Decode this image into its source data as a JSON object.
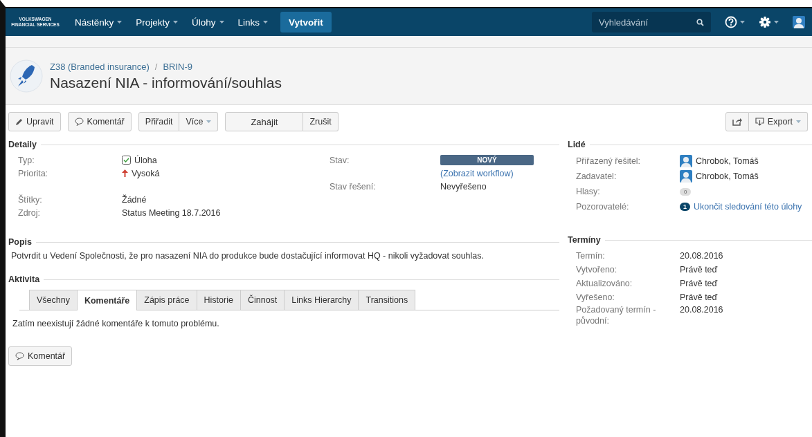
{
  "nav": {
    "logo": [
      "VOLKSWAGEN",
      "FINANCIAL SERVICES"
    ],
    "menus": [
      {
        "label": "Nástěnky"
      },
      {
        "label": "Projekty"
      },
      {
        "label": "Úlohy"
      },
      {
        "label": "Links"
      }
    ],
    "create": "Vytvořit",
    "search": {
      "placeholder": "Vyhledávání"
    }
  },
  "header": {
    "breadcrumb": [
      "Z38 (Branded insurance)",
      "BRIN-9"
    ],
    "separator": "/",
    "title": "Nasazení NIA - informování/souhlas"
  },
  "toolbar": {
    "groups": [
      [
        {
          "label": "Upravit",
          "kind": "edit"
        }
      ],
      [
        {
          "label": "Komentář",
          "kind": "comment"
        }
      ],
      [
        {
          "label": "Přiřadit",
          "kind": "plain"
        },
        {
          "label": "Více",
          "kind": "menu"
        }
      ],
      [
        {
          "label": "Zahájit",
          "kind": "wide"
        },
        {
          "label": "Zrušit",
          "kind": "plain"
        }
      ]
    ],
    "export": "Export"
  },
  "details": {
    "title": "Detaily",
    "left": [
      {
        "label": "Typ:",
        "value": "Úloha",
        "kind": "type"
      },
      {
        "label": "Priorita:",
        "value": "Vysoká",
        "kind": "priority"
      },
      {
        "kind": "blank"
      },
      {
        "label": "Štítky:",
        "value": "Žádné",
        "kind": "text"
      },
      {
        "label": "Zdroj:",
        "value": "Status Meeting 18.7.2016",
        "kind": "text"
      }
    ],
    "right": [
      {
        "label": "Stav:",
        "value": "NOVÝ",
        "kind": "lozenge"
      },
      {
        "value": "(Zobrazit workflow)",
        "kind": "link"
      },
      {
        "label": "Stav řešení:",
        "value": "Nevyřešeno",
        "kind": "text"
      }
    ]
  },
  "description": {
    "title": "Popis",
    "text": "Potvrdit u Vedení Společnosti, že pro nasazení NIA do produkce bude dostačující informovat HQ - nikoli vyžadovat souhlas."
  },
  "activity": {
    "title": "Aktivita",
    "tabs": [
      {
        "label": "Všechny",
        "selected": false
      },
      {
        "label": "Komentáře",
        "selected": true
      },
      {
        "label": "Zápis práce",
        "selected": false
      },
      {
        "label": "Historie",
        "selected": false
      },
      {
        "label": "Činnost",
        "selected": false
      },
      {
        "label": "Links Hierarchy",
        "selected": false
      },
      {
        "label": "Transitions",
        "selected": false
      }
    ],
    "empty": "Zatím neexistují žádné komentáře k tomuto problému.",
    "button": "Komentář"
  },
  "people": {
    "title": "Lidé",
    "rows": [
      {
        "label": "Přiřazený řešitel:",
        "value": "Chrobok, Tomáš",
        "kind": "user"
      },
      {
        "label": "Zadavatel:",
        "value": "Chrobok, Tomáš",
        "kind": "user"
      },
      {
        "label": "Hlasy:",
        "value": "0",
        "kind": "count"
      },
      {
        "label": "Pozorovatelé:",
        "count": "1",
        "value": "Ukončit sledování této úlohy",
        "kind": "watch"
      }
    ]
  },
  "dates": {
    "title": "Termíny",
    "rows": [
      {
        "label": "Termín:",
        "value": "20.08.2016"
      },
      {
        "label": "Vytvořeno:",
        "value": "Právě teď"
      },
      {
        "label": "Aktualizováno:",
        "value": "Právě teď"
      },
      {
        "label": "Vyřešeno:",
        "value": "Právě teď"
      },
      {
        "label": "Požadovaný termín - původní:",
        "value": "20.08.2016"
      }
    ]
  }
}
